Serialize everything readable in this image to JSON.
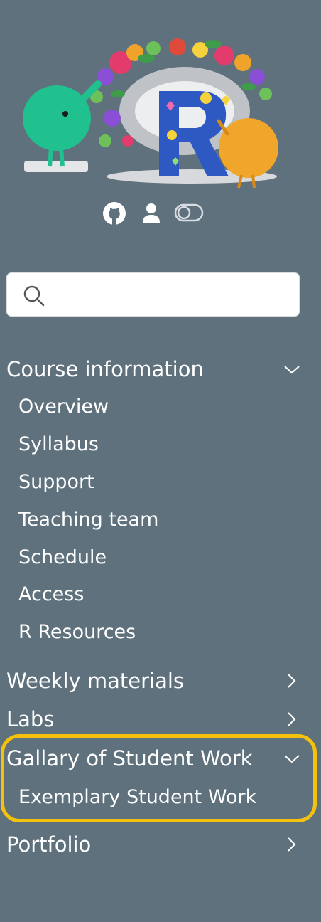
{
  "icons": {
    "logo": "r-course-logo-with-monsters",
    "github": "github-icon",
    "person": "person-icon",
    "toggle": "toggle-icon",
    "search": "search-icon",
    "chevron_down": "chevron-down-icon",
    "chevron_right": "chevron-right-icon"
  },
  "colors": {
    "sidebar_bg": "#5f717c",
    "highlight": "#f4c20d",
    "text": "#ffffff"
  },
  "search": {
    "placeholder": ""
  },
  "nav": {
    "course_information": {
      "label": "Course information",
      "expanded": true,
      "children": [
        "Overview",
        "Syllabus",
        "Support",
        "Teaching team",
        "Schedule",
        "Access",
        "R Resources"
      ]
    },
    "weekly_materials": {
      "label": "Weekly materials",
      "expanded": false
    },
    "labs": {
      "label": "Labs",
      "expanded": false
    },
    "gallery": {
      "label": "Gallary of Student Work",
      "expanded": true,
      "children": [
        "Exemplary Student Work"
      ]
    },
    "portfolio": {
      "label": "Portfolio",
      "expanded": false
    }
  }
}
